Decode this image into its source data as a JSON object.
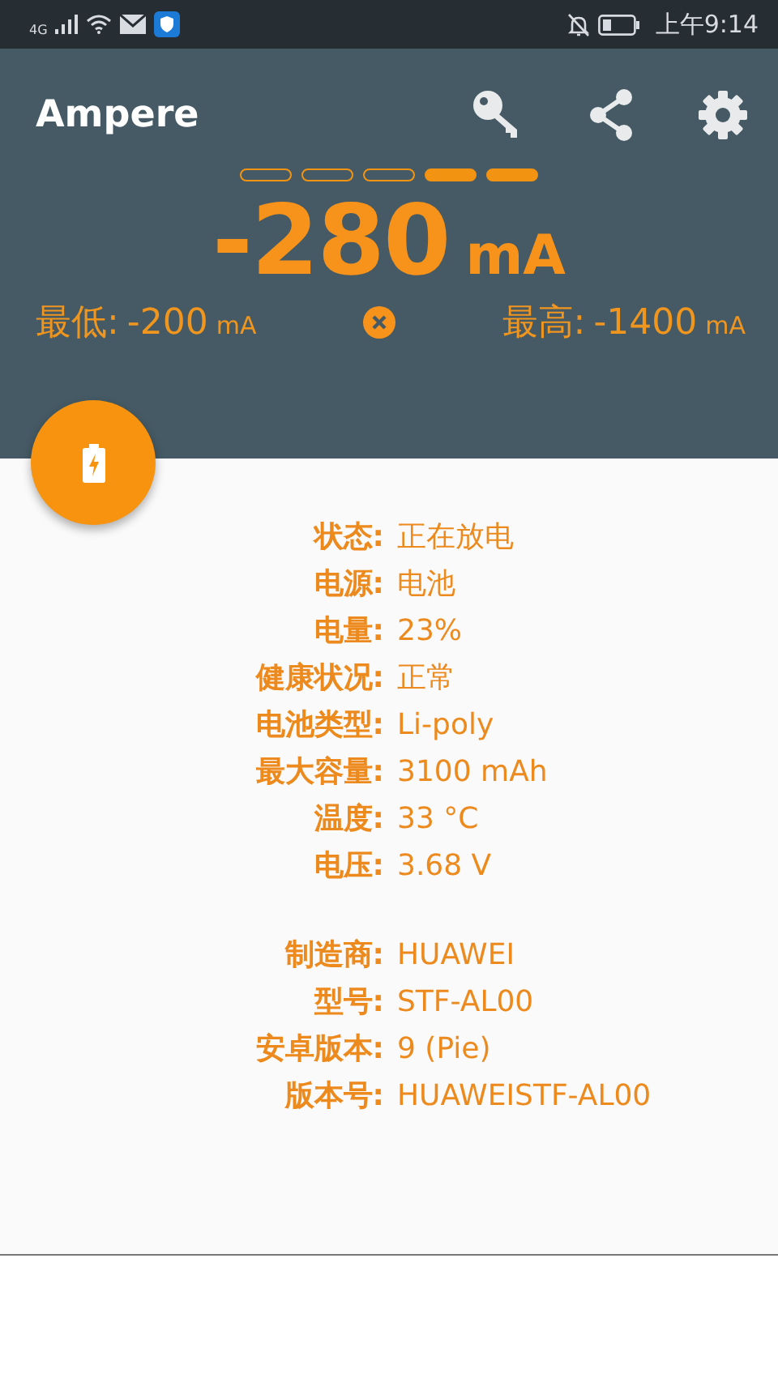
{
  "status_bar": {
    "network": "4G",
    "time": "上午9:14"
  },
  "app_bar": {
    "title": "Ampere"
  },
  "meter": {
    "segments": [
      {
        "on": false
      },
      {
        "on": false
      },
      {
        "on": false
      },
      {
        "on": true
      },
      {
        "on": true
      }
    ]
  },
  "current": {
    "value": "-280",
    "unit": "mA"
  },
  "min": {
    "label": "最低:",
    "value": "-200",
    "unit": "mA"
  },
  "max": {
    "label": "最高:",
    "value": "-1400",
    "unit": "mA"
  },
  "info_groups": [
    [
      {
        "label": "状态:",
        "value": "正在放电"
      },
      {
        "label": "电源:",
        "value": "电池"
      },
      {
        "label": "电量:",
        "value": "23%"
      },
      {
        "label": "健康状况:",
        "value": "正常"
      },
      {
        "label": "电池类型:",
        "value": "Li-poly"
      },
      {
        "label": "最大容量:",
        "value": "3100 mAh"
      },
      {
        "label": "温度:",
        "value": "33 °C"
      },
      {
        "label": "电压:",
        "value": "3.68 V"
      }
    ],
    [
      {
        "label": "制造商:",
        "value": "HUAWEI"
      },
      {
        "label": "型号:",
        "value": "STF-AL00"
      },
      {
        "label": "安卓版本:",
        "value": "9 (Pie)"
      },
      {
        "label": "版本号:",
        "value": "HUAWEISTF-AL00"
      }
    ]
  ]
}
